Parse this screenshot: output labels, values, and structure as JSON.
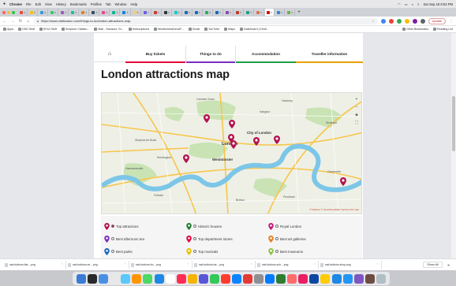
{
  "menubar": {
    "app_name": "Chrome",
    "items": [
      "File",
      "Edit",
      "View",
      "History",
      "Bookmarks",
      "Profiles",
      "Tab",
      "Window",
      "Help"
    ],
    "clock": "Sat Sep 18 8:53 PM"
  },
  "tabs": [
    {
      "color": "#e74c3c"
    },
    {
      "color": "#f1c40f"
    },
    {
      "color": "#3498db"
    },
    {
      "color": "#2ecc71"
    },
    {
      "color": "#9b59b6"
    },
    {
      "color": "#1abc9c"
    },
    {
      "color": "#e67e22"
    },
    {
      "color": "#34495e"
    },
    {
      "color": "#e84393"
    },
    {
      "color": "#00b894"
    },
    {
      "color": "#0984e3"
    },
    {
      "color": "#fdcb6e"
    },
    {
      "color": "#6c5ce7"
    },
    {
      "color": "#d63031"
    },
    {
      "color": "#2d3436"
    },
    {
      "color": "#00cec9"
    },
    {
      "color": "#1565c0"
    },
    {
      "color": "#1565c0"
    },
    {
      "color": "#27ae60"
    },
    {
      "color": "#1565c0"
    },
    {
      "color": "#8e44ad"
    },
    {
      "color": "#c0392b"
    },
    {
      "color": "#16a085"
    },
    {
      "color": "#e17055"
    },
    {
      "color": "#d50000",
      "active": true
    },
    {
      "color": "#2e86de"
    },
    {
      "color": "#6ab04c"
    }
  ],
  "toolbar": {
    "url": "https://www.visitlondon.com/things-to-do/london-attractions-map",
    "update_label": "Update"
  },
  "bookmarks": {
    "items": [
      "Apps",
      "DSD Stuff",
      "BYUI Stuff",
      "Scripture Citation...",
      "Mail - Samsoni, St...",
      "Subscriptions",
      "MindfulnessDenaF...",
      "Gmail",
      "YouTube",
      "Maps",
      "Dashboard | Kindl..."
    ],
    "right_items": [
      "Other Bookmarks",
      "Reading List"
    ]
  },
  "site_nav": {
    "home_icon": "home-icon",
    "items": [
      {
        "label": "Buy tickets",
        "color": "#e4003b",
        "active": false
      },
      {
        "label": "Things to do",
        "color": "#7b2cbf",
        "active": true
      },
      {
        "label": "Accommodation",
        "color": "#1e9e4a",
        "active": false
      },
      {
        "label": "Traveller information",
        "color": "#e6a100",
        "active": false
      }
    ]
  },
  "page_title": "London attractions map",
  "map": {
    "labels": {
      "camden": "Camden Town",
      "london": "London",
      "city": "City of London",
      "westminster": "Westminster",
      "shepherds": "Shepherd's Bush",
      "kensington": "Kensington",
      "hammersmith": "Hammersmith",
      "fulham": "Fulham",
      "stratford": "Stratford",
      "greenwich": "Greenwich",
      "brixton": "Brixton",
      "peckham": "Peckham",
      "hackney": "Hackney",
      "islington": "Islington"
    },
    "attribution": "© Mapbox © OpenStreetMap Improve this map",
    "pin_color": "#b3124e"
  },
  "legend": [
    {
      "label": "Top attractions",
      "color": "#b3124e",
      "checked": true
    },
    {
      "label": "Historic houses",
      "color": "#1e7d32",
      "checked": false
    },
    {
      "label": "Royal London",
      "color": "#c2187a",
      "checked": false
    },
    {
      "label": "Best afternoon tea",
      "color": "#7b2cbf",
      "checked": false
    },
    {
      "label": "Top department stores",
      "color": "#e4003b",
      "checked": false
    },
    {
      "label": "Best art galleries",
      "color": "#e67e22",
      "checked": false
    },
    {
      "label": "Best parks",
      "color": "#1565c0",
      "checked": false
    },
    {
      "label": "Top musicals",
      "color": "#e6c200",
      "checked": false
    },
    {
      "label": "Best museums",
      "color": "#8bc34a",
      "checked": false
    }
  ],
  "downloads": {
    "items": [
      "ssd-buttons-fab....png",
      "ssd-buttons-se....png",
      "ssd-buttons-bo....png",
      "ssd-buttons-ba....png",
      "ssd-buttons-sch....png",
      "ssd-buttons-shop.png"
    ],
    "show_all": "Show All"
  },
  "dock": [
    "#3a7bd5",
    "#2a2a2a",
    "#4a90e2",
    "#e8e8e8",
    "#5ac8fa",
    "#ff9500",
    "#4cd964",
    "#1e88e5",
    "#ffffff",
    "#ff2d55",
    "#f4b400",
    "#5856d6",
    "#34c759",
    "#ff3b30",
    "#0a84ff",
    "#e53935",
    "#8e8e93",
    "#007aff",
    "#2e7d32",
    "#ff6b6b",
    "#e91e63",
    "#0d47a1",
    "#ffcc00",
    "#1e88e5",
    "#2196f3",
    "#7e57c2",
    "#6d4c41",
    "#b0bec5"
  ]
}
